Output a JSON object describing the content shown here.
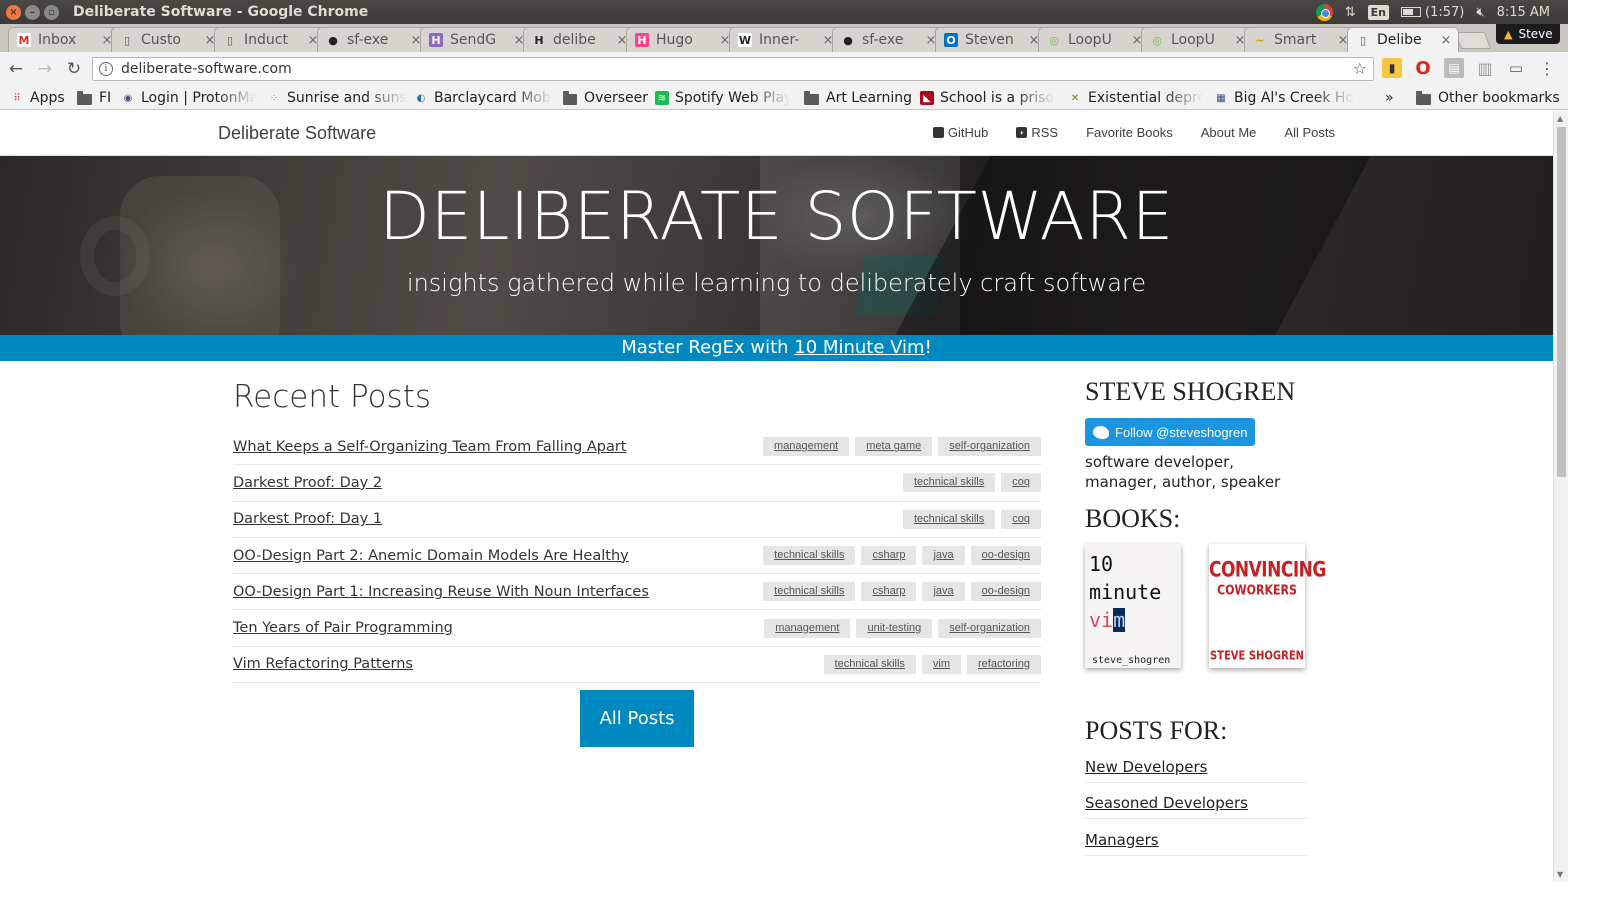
{
  "window": {
    "title": "Deliberate Software - Google Chrome",
    "battery": "(1:57)",
    "keyboard_layout": "En",
    "clock": "8:15 AM"
  },
  "tabs": [
    {
      "label": "Inbox",
      "icon": "gmail-icon",
      "active": false
    },
    {
      "label": "Custo",
      "icon": "page-icon",
      "active": false
    },
    {
      "label": "Induct",
      "icon": "page-icon",
      "active": false
    },
    {
      "label": "sf-exe",
      "icon": "github-icon",
      "active": false
    },
    {
      "label": "SendG",
      "icon": "hackmd-icon",
      "active": false
    },
    {
      "label": "delibe",
      "icon": "hacker-h-icon",
      "active": false
    },
    {
      "label": "Hugo",
      "icon": "hugo-icon",
      "active": false
    },
    {
      "label": "Inner-",
      "icon": "wikipedia-icon",
      "active": false
    },
    {
      "label": "sf-exe",
      "icon": "github-icon",
      "active": false
    },
    {
      "label": "Steven",
      "icon": "outlook-icon",
      "active": false
    },
    {
      "label": "LoopU",
      "icon": "loop-icon",
      "active": false
    },
    {
      "label": "LoopU",
      "icon": "loop-icon",
      "active": false
    },
    {
      "label": "Smart",
      "icon": "smart-icon",
      "active": false
    },
    {
      "label": "Delibe",
      "icon": "page-icon",
      "active": true
    }
  ],
  "profile": {
    "name": "Steve"
  },
  "toolbar": {
    "url": "deliberate-software.com"
  },
  "bookmarks": [
    {
      "label": "Apps",
      "icon": "apps-grid-icon"
    },
    {
      "label": "FI",
      "icon": "folder-icon"
    },
    {
      "label": "Login | ProtonMa",
      "icon": "protonmail-icon"
    },
    {
      "label": "Sunrise and suns",
      "icon": "sunrise-icon"
    },
    {
      "label": "Barclaycard Mob",
      "icon": "barclaycard-icon"
    },
    {
      "label": "Overseer",
      "icon": "folder-icon"
    },
    {
      "label": "Spotify Web Play",
      "icon": "spotify-icon"
    },
    {
      "label": "Art Learning",
      "icon": "folder-icon"
    },
    {
      "label": "School is a prison",
      "icon": "school-icon"
    },
    {
      "label": "Existential depre",
      "icon": "x-icon"
    },
    {
      "label": "Big Al's Creek Ho",
      "icon": "calendar-icon"
    },
    {
      "label": "»",
      "icon": ""
    },
    {
      "label": "Other bookmarks",
      "icon": "folder-icon"
    }
  ],
  "site": {
    "brand": "Deliberate Software",
    "nav": [
      {
        "label": "GitHub",
        "icon": "github-icon"
      },
      {
        "label": "RSS",
        "icon": "rss-icon"
      },
      {
        "label": "Favorite Books"
      },
      {
        "label": "About Me"
      },
      {
        "label": "All Posts"
      }
    ],
    "hero_title": "DELIBERATE SOFTWARE",
    "hero_subtitle": "insights gathered while learning to deliberately craft software",
    "promo_prefix": "Master RegEx with ",
    "promo_link": "10 Minute Vim",
    "promo_suffix": "!"
  },
  "recent_posts": {
    "heading": "Recent Posts",
    "posts": [
      {
        "title": "What Keeps a Self-Organizing Team From Falling Apart",
        "tags": [
          "management",
          "meta game",
          "self-organization"
        ]
      },
      {
        "title": "Darkest Proof: Day 2",
        "tags": [
          "technical skills",
          "coq"
        ]
      },
      {
        "title": "Darkest Proof: Day 1",
        "tags": [
          "technical skills",
          "coq"
        ]
      },
      {
        "title": "OO-Design Part 2: Anemic Domain Models Are Healthy",
        "tags": [
          "technical skills",
          "csharp",
          "java",
          "oo-design"
        ]
      },
      {
        "title": "OO-Design Part 1: Increasing Reuse With Noun Interfaces",
        "tags": [
          "technical skills",
          "csharp",
          "java",
          "oo-design"
        ]
      },
      {
        "title": "Ten Years of Pair Programming",
        "tags": [
          "management",
          "unit-testing",
          "self-organization"
        ]
      },
      {
        "title": "Vim Refactoring Patterns",
        "tags": [
          "technical skills",
          "vim",
          "refactoring"
        ]
      }
    ],
    "all_posts_button": "All Posts"
  },
  "sidebar": {
    "author_heading": "STEVE SHOGREN",
    "follow_button": "Follow @steveshogren",
    "bio": "software developer, manager, author, speaker",
    "books_heading": "BOOKS:",
    "book1": {
      "line1": "10",
      "line2": "minute",
      "vi": "vi",
      "cursor": "m",
      "author": "steve_shogren"
    },
    "book2": {
      "title_line1": "CONVINCING",
      "title_line2": "COWORKERS",
      "author": "STEVE SHOGREN"
    },
    "posts_for_heading": "POSTS FOR:",
    "posts_for": [
      "New Developers",
      "Seasoned Developers",
      "Managers"
    ]
  }
}
